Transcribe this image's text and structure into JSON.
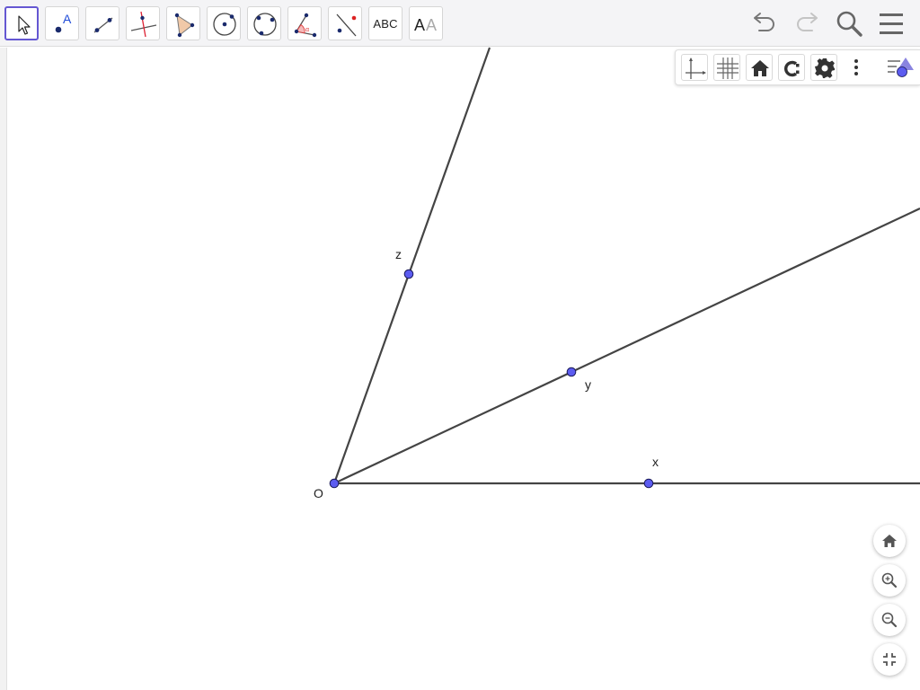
{
  "toolbar": {
    "tools": [
      {
        "name": "move-tool",
        "icon": "arrow-pointer-icon",
        "active": true
      },
      {
        "name": "point-tool",
        "icon": "point-icon",
        "label": "A"
      },
      {
        "name": "segment-tool",
        "icon": "segment-icon"
      },
      {
        "name": "perpendicular-tool",
        "icon": "perpendicular-line-icon"
      },
      {
        "name": "polygon-tool",
        "icon": "polygon-icon"
      },
      {
        "name": "circle-tool",
        "icon": "circle-center-point-icon"
      },
      {
        "name": "ellipse-tool",
        "icon": "circle-three-points-icon"
      },
      {
        "name": "angle-tool",
        "icon": "angle-icon",
        "label": "α"
      },
      {
        "name": "reflect-tool",
        "icon": "reflect-about-line-icon"
      },
      {
        "name": "text-tool",
        "icon": "text-icon",
        "label": "ABC"
      },
      {
        "name": "style-tool",
        "icon": "text-style-icon",
        "label": "AA"
      }
    ],
    "right": [
      "undo-icon",
      "redo-icon",
      "search-icon",
      "menu-icon"
    ]
  },
  "style_bar": {
    "buttons": [
      "axes-icon",
      "grid-icon",
      "home-icon",
      "labeling-icon",
      "gear-icon",
      "more-vertical-icon",
      "style-bar-toggle-icon"
    ]
  },
  "points": {
    "o": "O",
    "x": "x",
    "y": "y",
    "z": "z"
  },
  "zoom_controls": [
    "home-icon",
    "zoom-in-icon",
    "zoom-out-icon",
    "exit-fullscreen-icon"
  ],
  "colors": {
    "accent": "#6557d2",
    "point_fill": "#5c5cf0",
    "point_stroke": "#1a1a5a",
    "line": "#444444"
  }
}
